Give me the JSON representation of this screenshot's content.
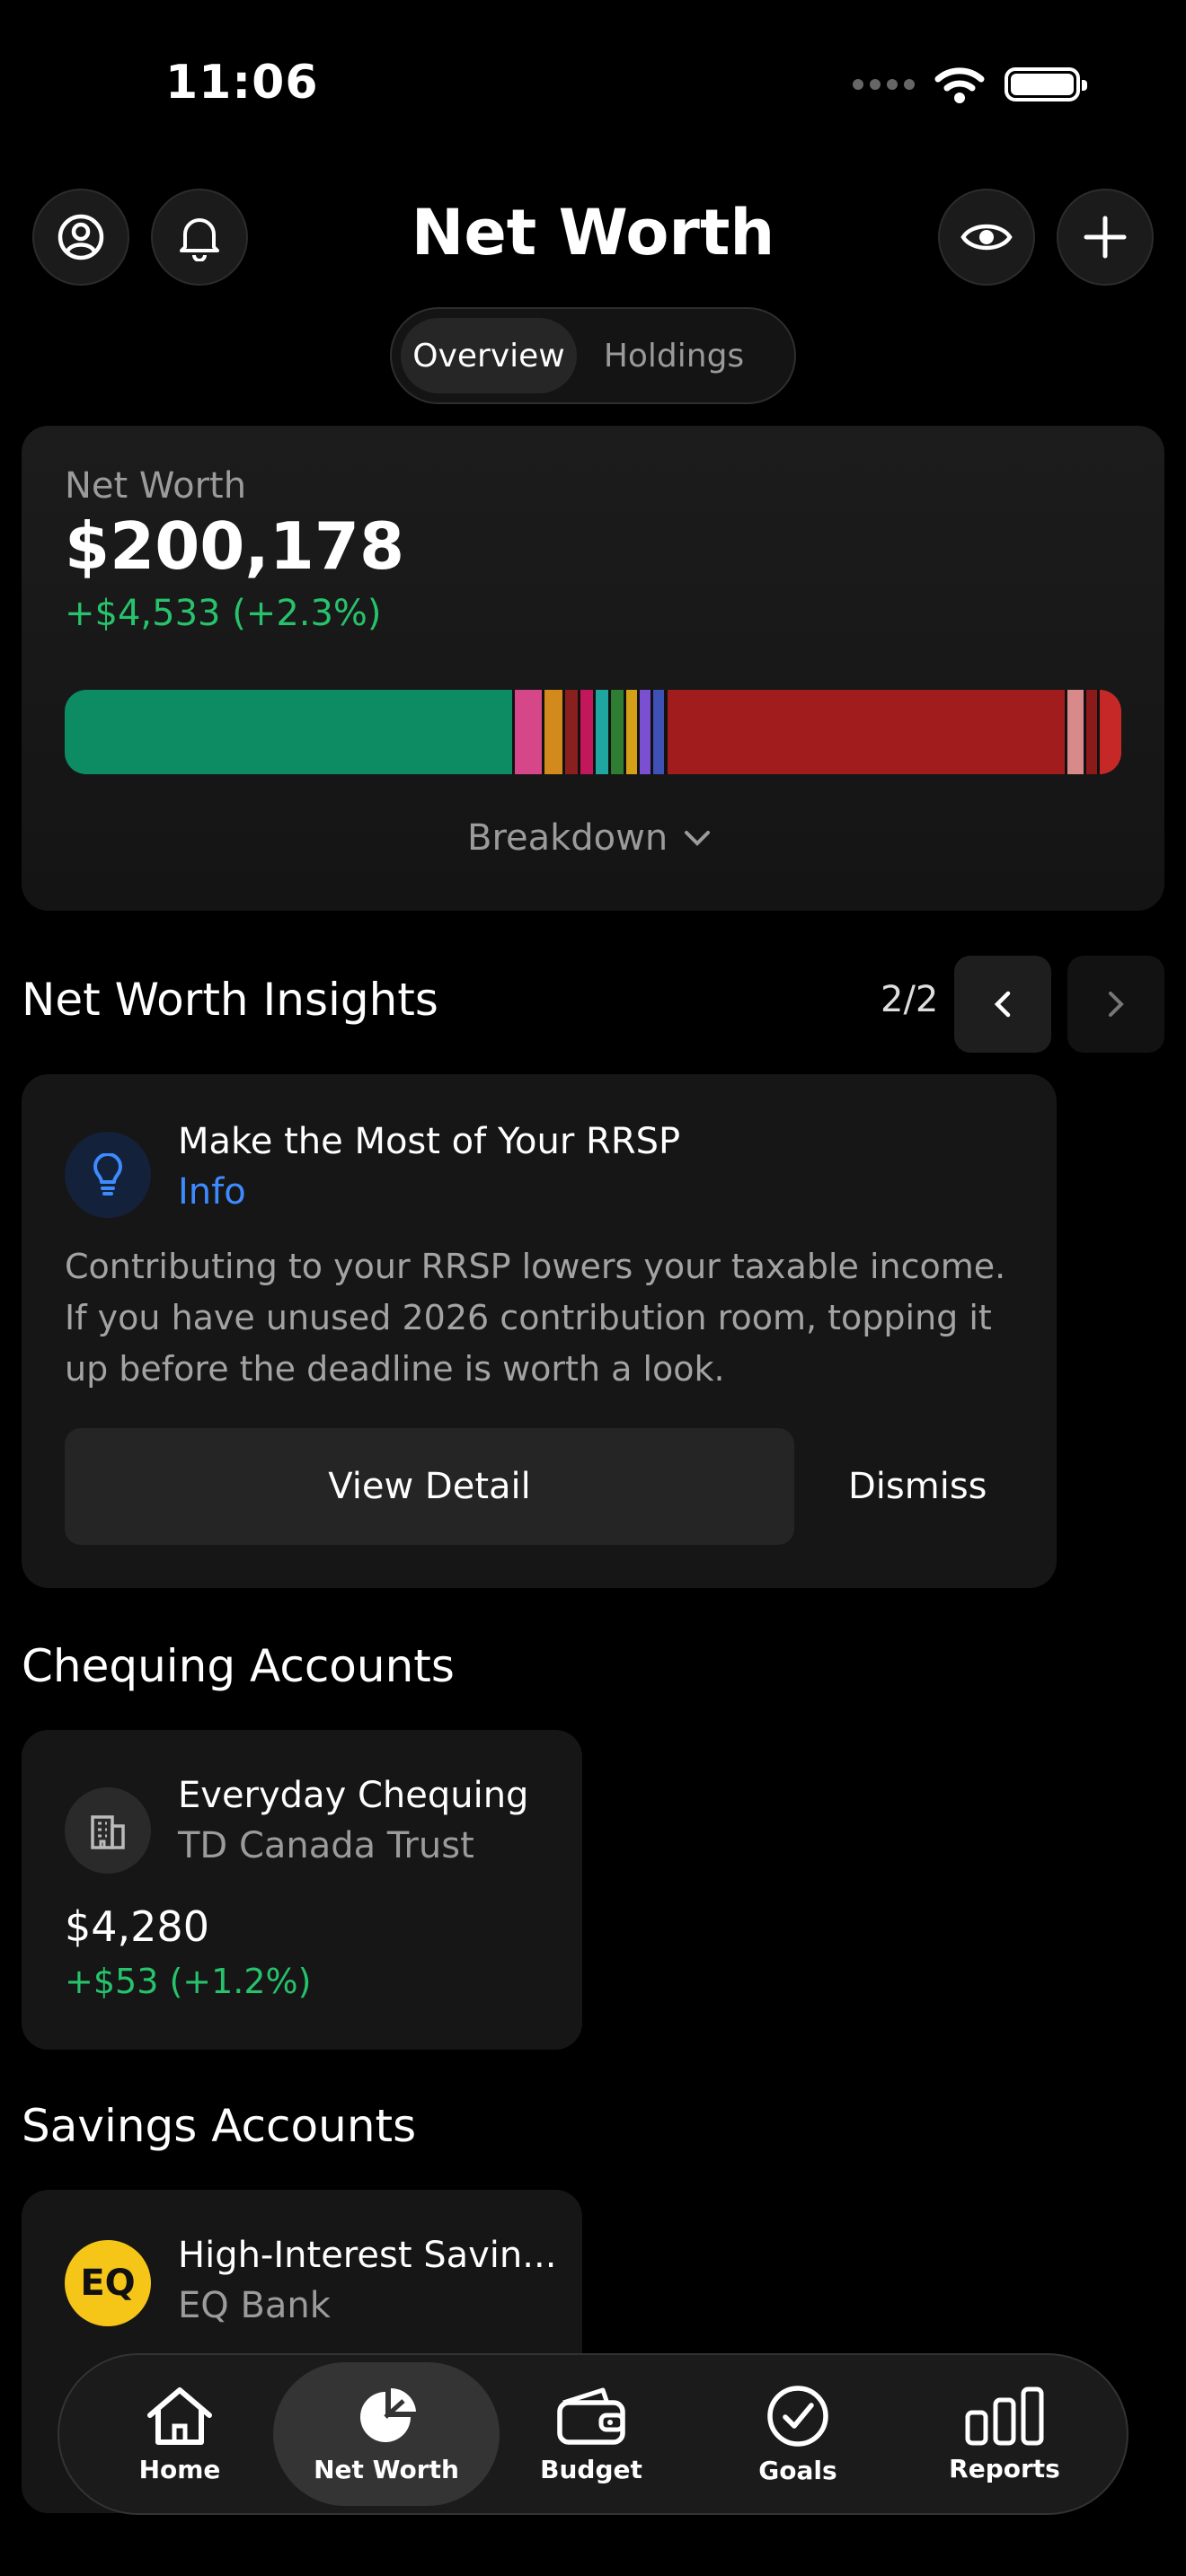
{
  "status_bar": {
    "time": "11:06"
  },
  "header": {
    "title": "Net Worth"
  },
  "tabs": [
    {
      "label": "Overview"
    },
    {
      "label": "Holdings"
    }
  ],
  "net_worth": {
    "label": "Net Worth",
    "value": "$200,178",
    "change": "+$4,533 (+2.3%)",
    "breakdown_label": "Breakdown",
    "segments_colors": [
      "#0d8b63",
      "#d6478a",
      "#d38a1c",
      "#8a1f1f",
      "#1fa6a0",
      "#c2185b",
      "#2e7d32",
      "#d4a017",
      "#7b4fd1",
      "#3f51b5",
      "#8b1a1a",
      "#c92b2b",
      "#d88a8a",
      "#8b1a1a",
      "#c62828"
    ]
  },
  "insights": {
    "title": "Net Worth Insights",
    "pager": "2/2",
    "card": {
      "title": "Make the Most of Your RRSP",
      "tag": "Info",
      "body": "Contributing to your RRSP lowers your taxable income. If you have unused 2026 contribution room, topping it up before the deadline is worth a look.",
      "primary_action": "View Detail",
      "secondary_action": "Dismiss"
    }
  },
  "chequing": {
    "title": "Chequing Accounts",
    "account": {
      "name": "Everyday Chequing",
      "institution": "TD Canada Trust",
      "balance": "$4,280",
      "change": "+$53 (+1.2%)"
    }
  },
  "savings": {
    "title": "Savings Accounts",
    "account": {
      "name": "High-Interest Savin...",
      "institution": "EQ Bank",
      "logo_text": "EQ"
    }
  },
  "tabbar": {
    "items": [
      {
        "label": "Home"
      },
      {
        "label": "Net Worth"
      },
      {
        "label": "Budget"
      },
      {
        "label": "Goals"
      },
      {
        "label": "Reports"
      }
    ]
  },
  "colors": {
    "accent_blue": "#3d8bff",
    "positive": "#27c26c",
    "eq_logo": "#f5c518"
  }
}
